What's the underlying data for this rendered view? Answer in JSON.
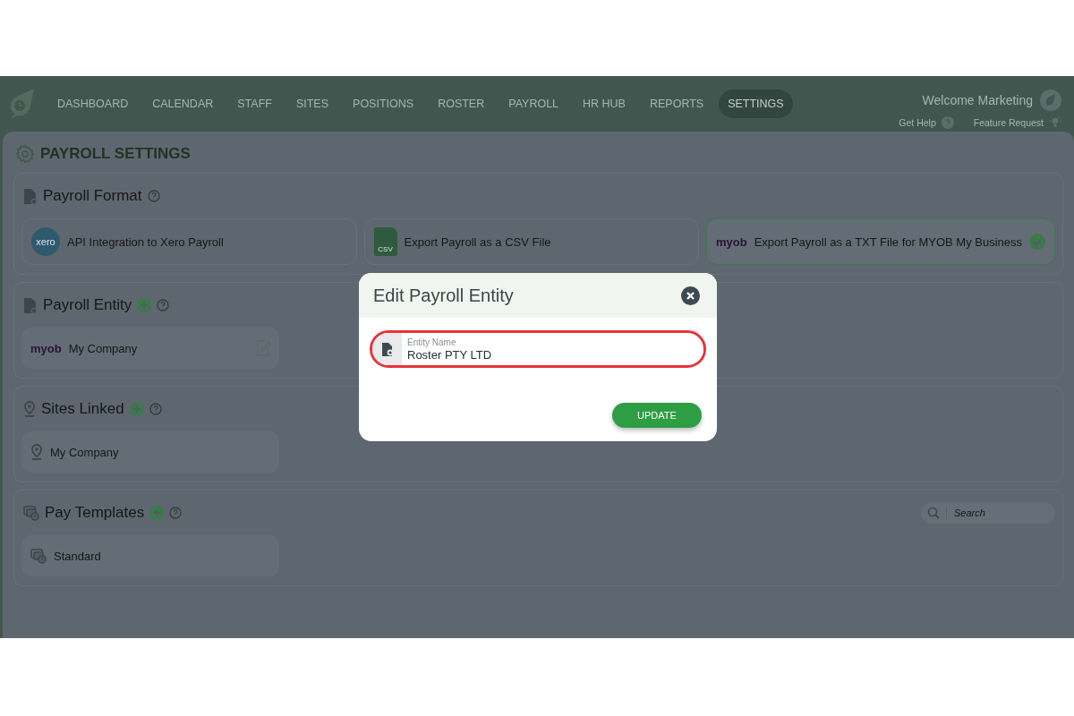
{
  "nav": {
    "items": [
      {
        "label": "DASHBOARD",
        "selected": false
      },
      {
        "label": "CALENDAR",
        "selected": false
      },
      {
        "label": "STAFF",
        "selected": false
      },
      {
        "label": "SITES",
        "selected": false
      },
      {
        "label": "POSITIONS",
        "selected": false
      },
      {
        "label": "ROSTER",
        "selected": false
      },
      {
        "label": "PAYROLL",
        "selected": false
      },
      {
        "label": "HR HUB",
        "selected": false
      },
      {
        "label": "REPORTS",
        "selected": false
      },
      {
        "label": "SETTINGS",
        "selected": true
      }
    ],
    "welcome": "Welcome Marketing",
    "links": [
      {
        "kind": "help",
        "label": "Get Help"
      },
      {
        "kind": "idea",
        "label": "Feature Request"
      }
    ]
  },
  "page": {
    "title": "PAYROLL SETTINGS"
  },
  "sections": [
    {
      "kind": "formats",
      "title": "Payroll Format",
      "can_add": false,
      "options": [
        {
          "kind": "xero",
          "logo_text": "xero",
          "label": "API Integration to Xero Payroll",
          "selected": false
        },
        {
          "kind": "csv",
          "logo_text": "CSV",
          "label": "Export Payroll as a CSV File",
          "selected": false
        },
        {
          "kind": "myob",
          "logo_text": "myob",
          "label": "Export Payroll as a TXT File for MYOB My Business",
          "selected": true
        }
      ]
    },
    {
      "kind": "entities",
      "title": "Payroll Entity",
      "can_add": true,
      "items": [
        {
          "logo_text": "myob",
          "label": "My Company"
        }
      ]
    },
    {
      "kind": "sites",
      "title": "Sites Linked",
      "can_add": true,
      "items": [
        {
          "label": "My Company"
        }
      ]
    },
    {
      "kind": "templates",
      "title": "Pay Templates",
      "can_add": true,
      "search": {
        "placeholder": "Search"
      },
      "items": [
        {
          "label": "Standard"
        }
      ]
    }
  ],
  "modal": {
    "title": "Edit Payroll Entity",
    "field": {
      "label": "Entity Name",
      "value": "Roster PTY LTD",
      "highlighted": true
    },
    "button": "UPDATE"
  }
}
